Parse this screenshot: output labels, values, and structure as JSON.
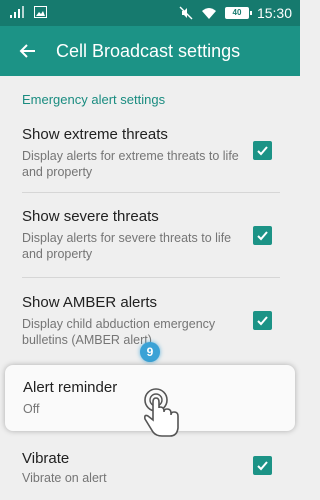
{
  "status_bar": {
    "time": "15:30",
    "battery": "40"
  },
  "app_bar": {
    "title": "Cell Broadcast settings"
  },
  "section": {
    "header": "Emergency alert settings"
  },
  "prefs": [
    {
      "title": "Show extreme threats",
      "summary": "Display alerts for extreme threats to life and property",
      "checked": true
    },
    {
      "title": "Show severe threats",
      "summary": "Display alerts for severe threats to life and property",
      "checked": true
    },
    {
      "title": "Show AMBER alerts",
      "summary": "Display child abduction emergency bulletins (AMBER alert)",
      "checked": true
    },
    {
      "title": "Alert reminder",
      "summary": "Off"
    },
    {
      "title": "Vibrate",
      "summary": "Vibrate on alert",
      "checked": true
    }
  ],
  "tutorial": {
    "step": "9"
  },
  "colors": {
    "status_bar": "#167a6e",
    "app_bar": "#1c9386",
    "accent": "#1c9386",
    "section_header": "#1a8c80"
  }
}
